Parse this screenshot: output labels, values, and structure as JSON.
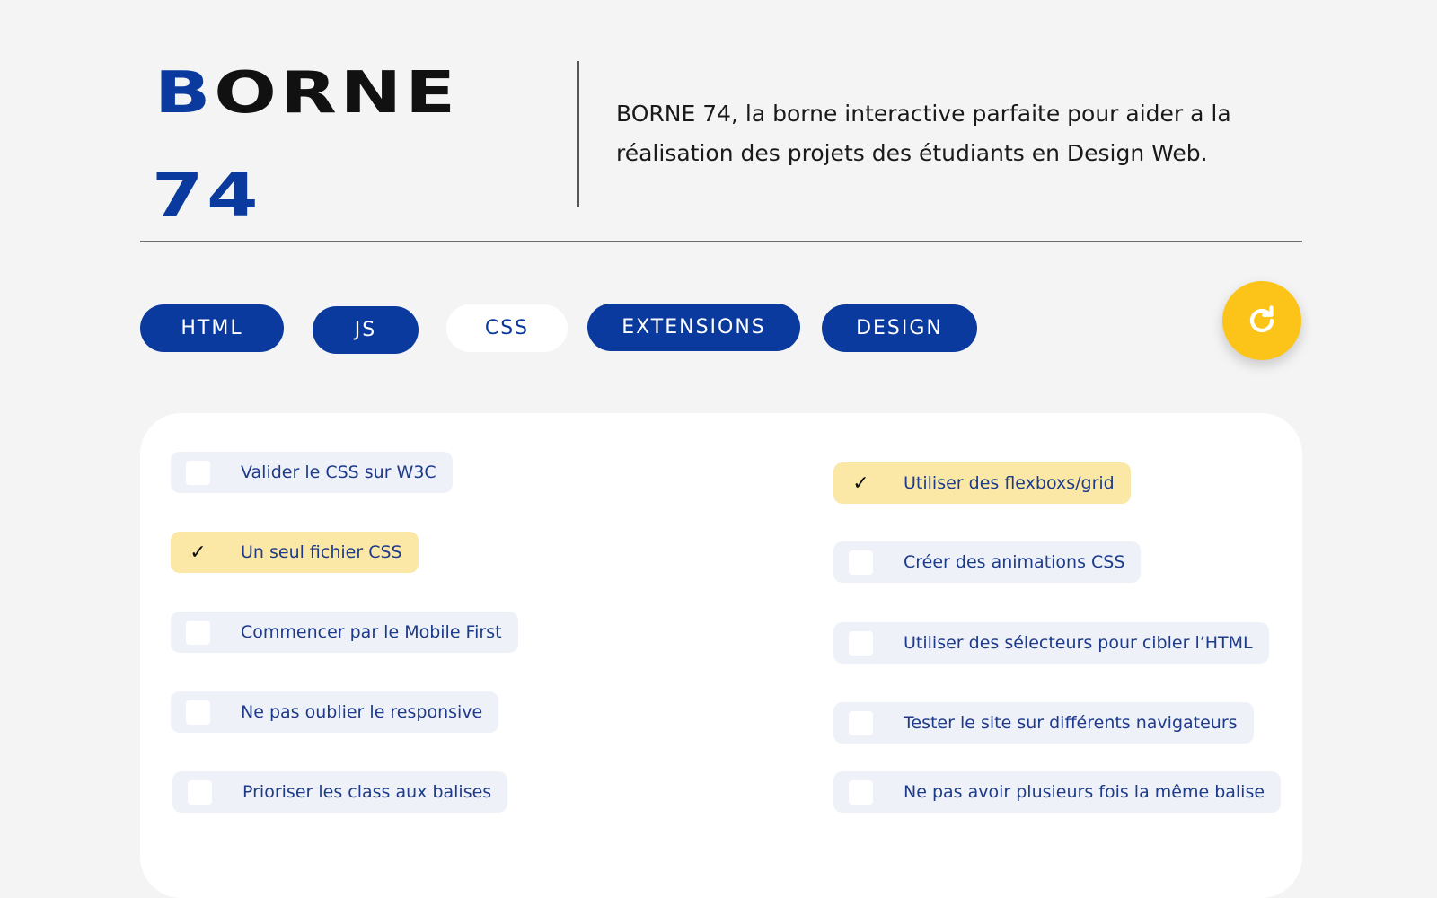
{
  "logo": {
    "line1_accent": "B",
    "line1_rest": "ORNE",
    "line2": "74"
  },
  "description": "BORNE 74, la borne interactive parfaite pour aider a la réalisation des projets des étudiants en Design Web.",
  "tabs": [
    {
      "label": "HTML",
      "active": false
    },
    {
      "label": "JS",
      "active": false
    },
    {
      "label": "CSS",
      "active": true
    },
    {
      "label": "EXTENSIONS",
      "active": false
    },
    {
      "label": "DESIGN",
      "active": false
    }
  ],
  "refresh_button": {
    "icon": "refresh-icon"
  },
  "tasks_left": [
    {
      "label": "Valider le CSS sur W3C",
      "checked": false
    },
    {
      "label": "Un seul fichier CSS",
      "checked": true
    },
    {
      "label": "Commencer par le Mobile First",
      "checked": false
    },
    {
      "label": "Ne pas oublier le responsive",
      "checked": false
    },
    {
      "label": "Prioriser les class aux balises",
      "checked": false
    }
  ],
  "tasks_right": [
    {
      "label": "Utiliser des flexboxs/grid",
      "checked": true
    },
    {
      "label": "Créer des animations CSS",
      "checked": false
    },
    {
      "label": "Utiliser des sélecteurs pour cibler l’HTML",
      "checked": false
    },
    {
      "label": "Tester le site sur différents navigateurs",
      "checked": false
    },
    {
      "label": "Ne pas avoir plusieurs fois la même balise",
      "checked": false
    }
  ],
  "checkmark": "✓",
  "colors": {
    "brand_blue": "#0a3a9e",
    "accent_yellow": "#fcc419",
    "checked_background": "#fce8a6",
    "task_background": "#eef1f8",
    "page_background": "#f4f4f4"
  }
}
